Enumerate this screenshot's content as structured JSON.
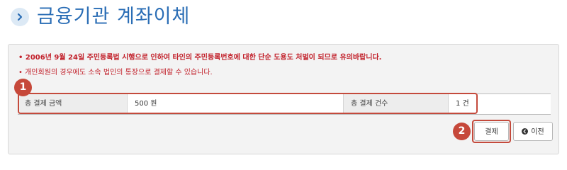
{
  "header": {
    "title": "금융기관 계좌이체",
    "icon": "chevron-right-icon"
  },
  "notices": [
    "• 2006년 9월 24일 주민등록법 시행으로 인하여 타인의 주민등록번호에 대한 단순 도용도 처벌이 되므로 유의바랍니다.",
    "• 개인회원의 경우에도 소속 법인의 통장으로 결제할 수 있습니다."
  ],
  "summary": {
    "total_amount_label": "총 결제 금액",
    "total_amount_value": "500 원",
    "total_count_label": "총 결제 건수",
    "total_count_value": "1 건"
  },
  "buttons": {
    "pay_label": "결제",
    "prev_label": "이전"
  },
  "annotations": {
    "step1": "1",
    "step2": "2"
  },
  "colors": {
    "title": "#2a6db5",
    "notice": "#c2212b",
    "highlight": "#c44a3c"
  }
}
